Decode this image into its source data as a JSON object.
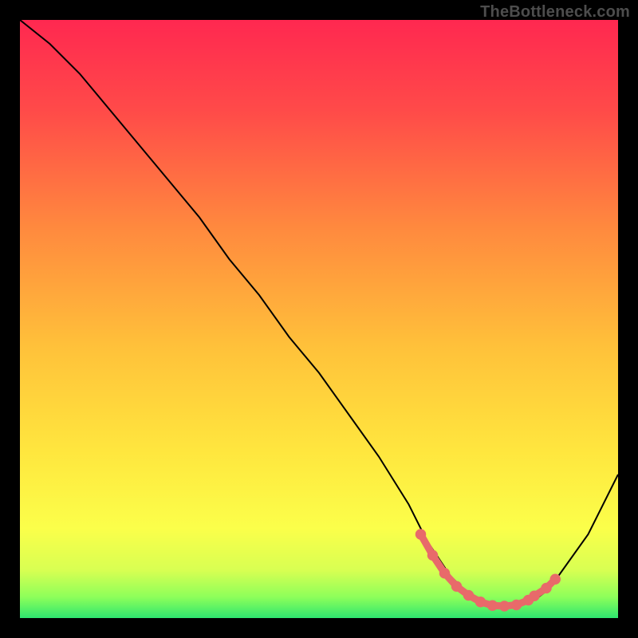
{
  "watermark": "TheBottleneck.com",
  "colors": {
    "bg": "#000000",
    "watermark": "#4d4d4d",
    "curve": "#000000",
    "dots": "#e86a6a",
    "greenBand": "#2ee66f"
  },
  "chart_data": {
    "type": "line",
    "title": "",
    "xlabel": "",
    "ylabel": "",
    "xlim": [
      0,
      100
    ],
    "ylim": [
      0,
      100
    ],
    "x": [
      0,
      5,
      10,
      15,
      20,
      25,
      30,
      35,
      40,
      45,
      50,
      55,
      60,
      65,
      68,
      70,
      72,
      74,
      76,
      78,
      80,
      82,
      84,
      86,
      88,
      90,
      95,
      100
    ],
    "y": [
      100,
      96,
      91,
      85,
      79,
      73,
      67,
      60,
      54,
      47,
      41,
      34,
      27,
      19,
      13,
      10,
      7,
      5,
      3.5,
      2.5,
      2,
      2,
      2.3,
      3,
      4.5,
      7,
      14,
      24
    ],
    "highlight_points": {
      "x": [
        67,
        69,
        71,
        73,
        75,
        77,
        79,
        81,
        83,
        85,
        86,
        88,
        89.5
      ],
      "y": [
        14,
        10.5,
        7.5,
        5.3,
        3.8,
        2.7,
        2.1,
        2.0,
        2.2,
        3.0,
        3.7,
        5.0,
        6.5
      ]
    },
    "gradient_stops": [
      {
        "offset": 0.0,
        "color": "#ff2850"
      },
      {
        "offset": 0.15,
        "color": "#ff4a49"
      },
      {
        "offset": 0.35,
        "color": "#ff8a3e"
      },
      {
        "offset": 0.55,
        "color": "#ffc23a"
      },
      {
        "offset": 0.72,
        "color": "#ffe63e"
      },
      {
        "offset": 0.85,
        "color": "#fbff4a"
      },
      {
        "offset": 0.92,
        "color": "#d8ff52"
      },
      {
        "offset": 0.965,
        "color": "#8dff5a"
      },
      {
        "offset": 1.0,
        "color": "#2ee66f"
      }
    ]
  }
}
